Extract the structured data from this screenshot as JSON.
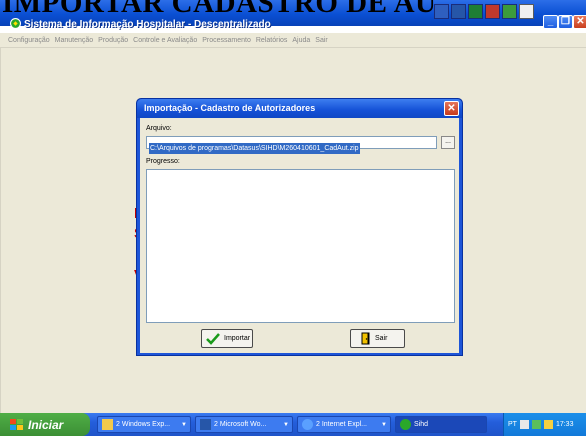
{
  "doc_title": "IMPORTAR CADASTRO DE AUTORIZ",
  "app": {
    "title": "Sistema de Informação Hospitalar - Descentralizado",
    "window_buttons": {
      "minimize": "_",
      "restore": "❐",
      "close": "✕"
    }
  },
  "menu": [
    "Configuração",
    "Manutenção",
    "Produção",
    "Controle e Avaliação",
    "Processamento",
    "Relatórios",
    "Ajuda",
    "Sair"
  ],
  "background_fragments": [
    "E",
    "S",
    "V"
  ],
  "dialog": {
    "title": "Importação - Cadastro de Autorizadores",
    "close": "✕",
    "file_label": "Arquivo:",
    "file_value": "C:\\Arquivos de programas\\Datasus\\SIHD\\M260410601_CadAut.zip",
    "browse_label": "...",
    "progress_label": "Progresso:",
    "import_label": "Importar",
    "exit_label": "Sair"
  },
  "taskbar": {
    "start_label": "Iniciar",
    "tasks": [
      "2 Windows Exp...",
      "2 Microsoft Wo...",
      "2 Internet Expl...",
      "Sihd"
    ],
    "tray_lang": "PT",
    "clock": "17:33"
  },
  "colors": {
    "xp_blue": "#0a4fd3",
    "start_green": "#3c8f35",
    "selection": "#316ac5",
    "accent_red": "#c00000"
  }
}
